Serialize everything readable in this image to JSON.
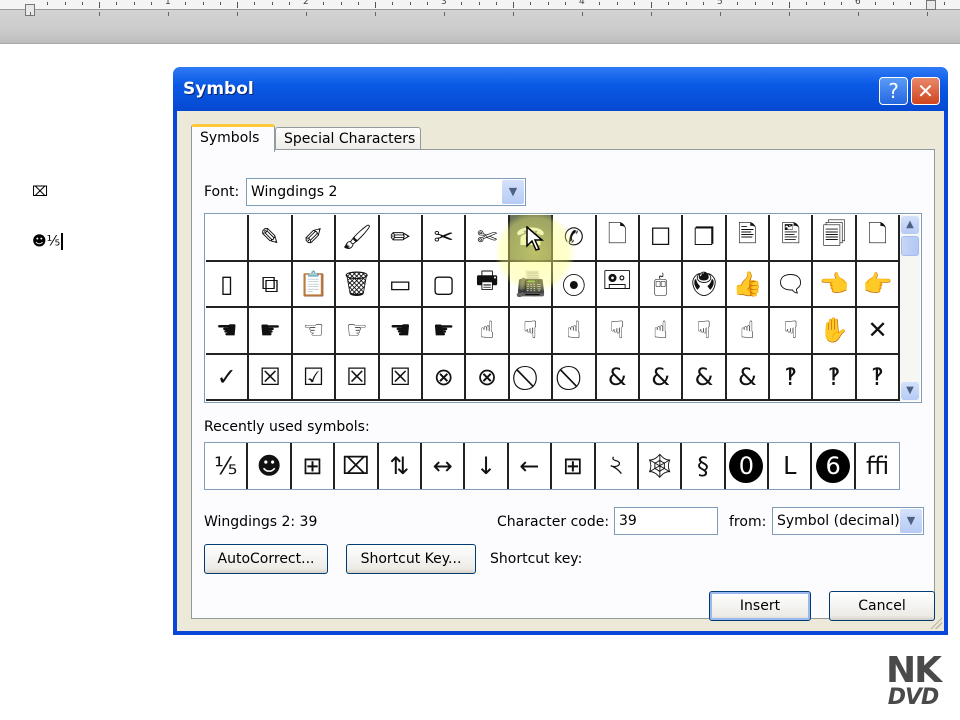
{
  "ruler": {
    "numbers": [
      "1",
      "2",
      "3",
      "4",
      "5",
      "6"
    ]
  },
  "document": {
    "lines": [
      "⌧",
      "☻⅕"
    ]
  },
  "dialog": {
    "title": "Symbol",
    "help_label": "?",
    "close_label": "✕",
    "tabs": [
      {
        "label": "Symbols",
        "accesskey": "S",
        "active": true
      },
      {
        "label": "Special Characters",
        "accesskey": "p",
        "active": false
      }
    ],
    "font": {
      "label": "Font:",
      "value": "Wingdings 2"
    },
    "symbol_grid": {
      "rows": [
        [
          "",
          "✎",
          "✐",
          "🖌",
          "✏",
          "✂",
          "✄",
          "☎",
          "✆",
          "🗋",
          "☐",
          "❐",
          "🖹",
          "🖺",
          "🗐",
          "🗋"
        ],
        [
          "▯",
          "⧉",
          "📋",
          "🗑",
          "▭",
          "▢",
          "🖶",
          "📠",
          "⦿",
          "🖭",
          "🖰",
          "🖲",
          "👍",
          "🗨",
          "👈",
          "👉"
        ],
        [
          "☚",
          "☛",
          "☜",
          "☞",
          "☚",
          "☛",
          "☝",
          "☟",
          "☝",
          "☟",
          "☝",
          "☟",
          "☝",
          "☟",
          "✋",
          "✕"
        ],
        [
          "✓",
          "☒",
          "☑",
          "☒",
          "☒",
          "⊗",
          "⊗",
          "⃠",
          "⃠",
          "&",
          "&",
          "&",
          "&",
          "‽",
          "‽",
          "‽"
        ]
      ],
      "selected_index": 7
    },
    "recent": {
      "label": "Recently used symbols:",
      "items": [
        "⅕",
        "☻",
        "⊞",
        "⌧",
        "⇅",
        "↔",
        "↓",
        "←",
        "⊞",
        "২",
        "🕸",
        "§",
        "0",
        "ᒪ",
        "6",
        "ﬃ"
      ],
      "circled_indices": [
        12,
        14
      ]
    },
    "info": "Wingdings 2: 39",
    "character_code": {
      "label": "Character code:",
      "value": "39"
    },
    "from": {
      "label": "from:",
      "value": "Symbol (decimal)"
    },
    "buttons": {
      "autocorrect": "AutoCorrect...",
      "shortcut_key": "Shortcut Key...",
      "insert": "Insert",
      "cancel": "Cancel"
    },
    "shortcut_label": "Shortcut key:"
  },
  "watermark": {
    "line1": "NK",
    "line2": "DVD"
  },
  "colors": {
    "title_bar": "#0a5ae6",
    "dialog_face": "#ece9d8",
    "selected_cell": "#6b7556",
    "tab_accent": "#ffc83c"
  }
}
